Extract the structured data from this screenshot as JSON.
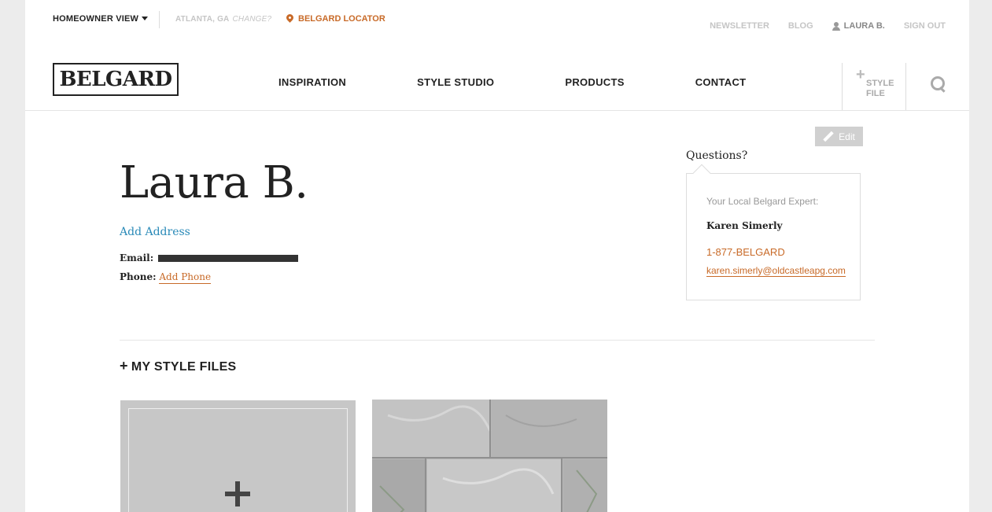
{
  "utility": {
    "view_toggle": "HOMEOWNER VIEW",
    "location": "ATLANTA, GA",
    "change": "CHANGE?",
    "locator": "BELGARD LOCATOR",
    "newsletter": "NEWSLETTER",
    "blog": "BLOG",
    "user": "LAURA B.",
    "signout": "SIGN OUT"
  },
  "header": {
    "logo": "BELGARD",
    "nav": [
      "INSPIRATION",
      "STYLE STUDIO",
      "PRODUCTS",
      "CONTACT"
    ],
    "style_file_label": "STYLE FILE"
  },
  "profile": {
    "name": "Laura B.",
    "add_address": "Add Address",
    "email_label": "Email:",
    "phone_label": "Phone:",
    "add_phone": "Add Phone",
    "edit_label": "Edit"
  },
  "questions": {
    "label": "Questions?",
    "expert_title": "Your Local Belgard Expert:",
    "expert_name": "Karen Simerly",
    "expert_phone": "1-877-BELGARD",
    "expert_email": "karen.simerly@oldcastleapg.com"
  },
  "style_files": {
    "header": "MY STYLE FILES"
  },
  "colors": {
    "accent": "#c86a28",
    "link_blue": "#2a8ab8",
    "background": "#ececec"
  }
}
